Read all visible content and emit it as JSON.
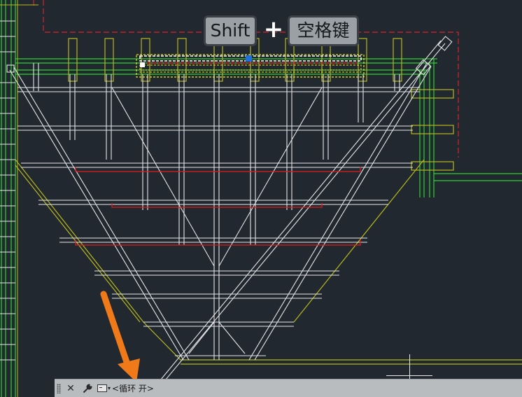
{
  "keys": {
    "shift": "Shift",
    "plus": "+",
    "space": "空格键"
  },
  "command_bar": {
    "close_icon": "close-icon",
    "settings_icon": "wrench-icon",
    "prompt_icon": "command-prompt-icon",
    "text": "<循环 开>"
  },
  "colors": {
    "background": "#212830",
    "white_lines": "#e6e6e6",
    "green_lines": "#2fd12f",
    "yellow_lines": "#b7b720",
    "red_lines": "#e01a1a",
    "arrow": "#f07a1a",
    "grip": "#1e6fe0",
    "command_bar_bg": "#b9bcbf"
  }
}
